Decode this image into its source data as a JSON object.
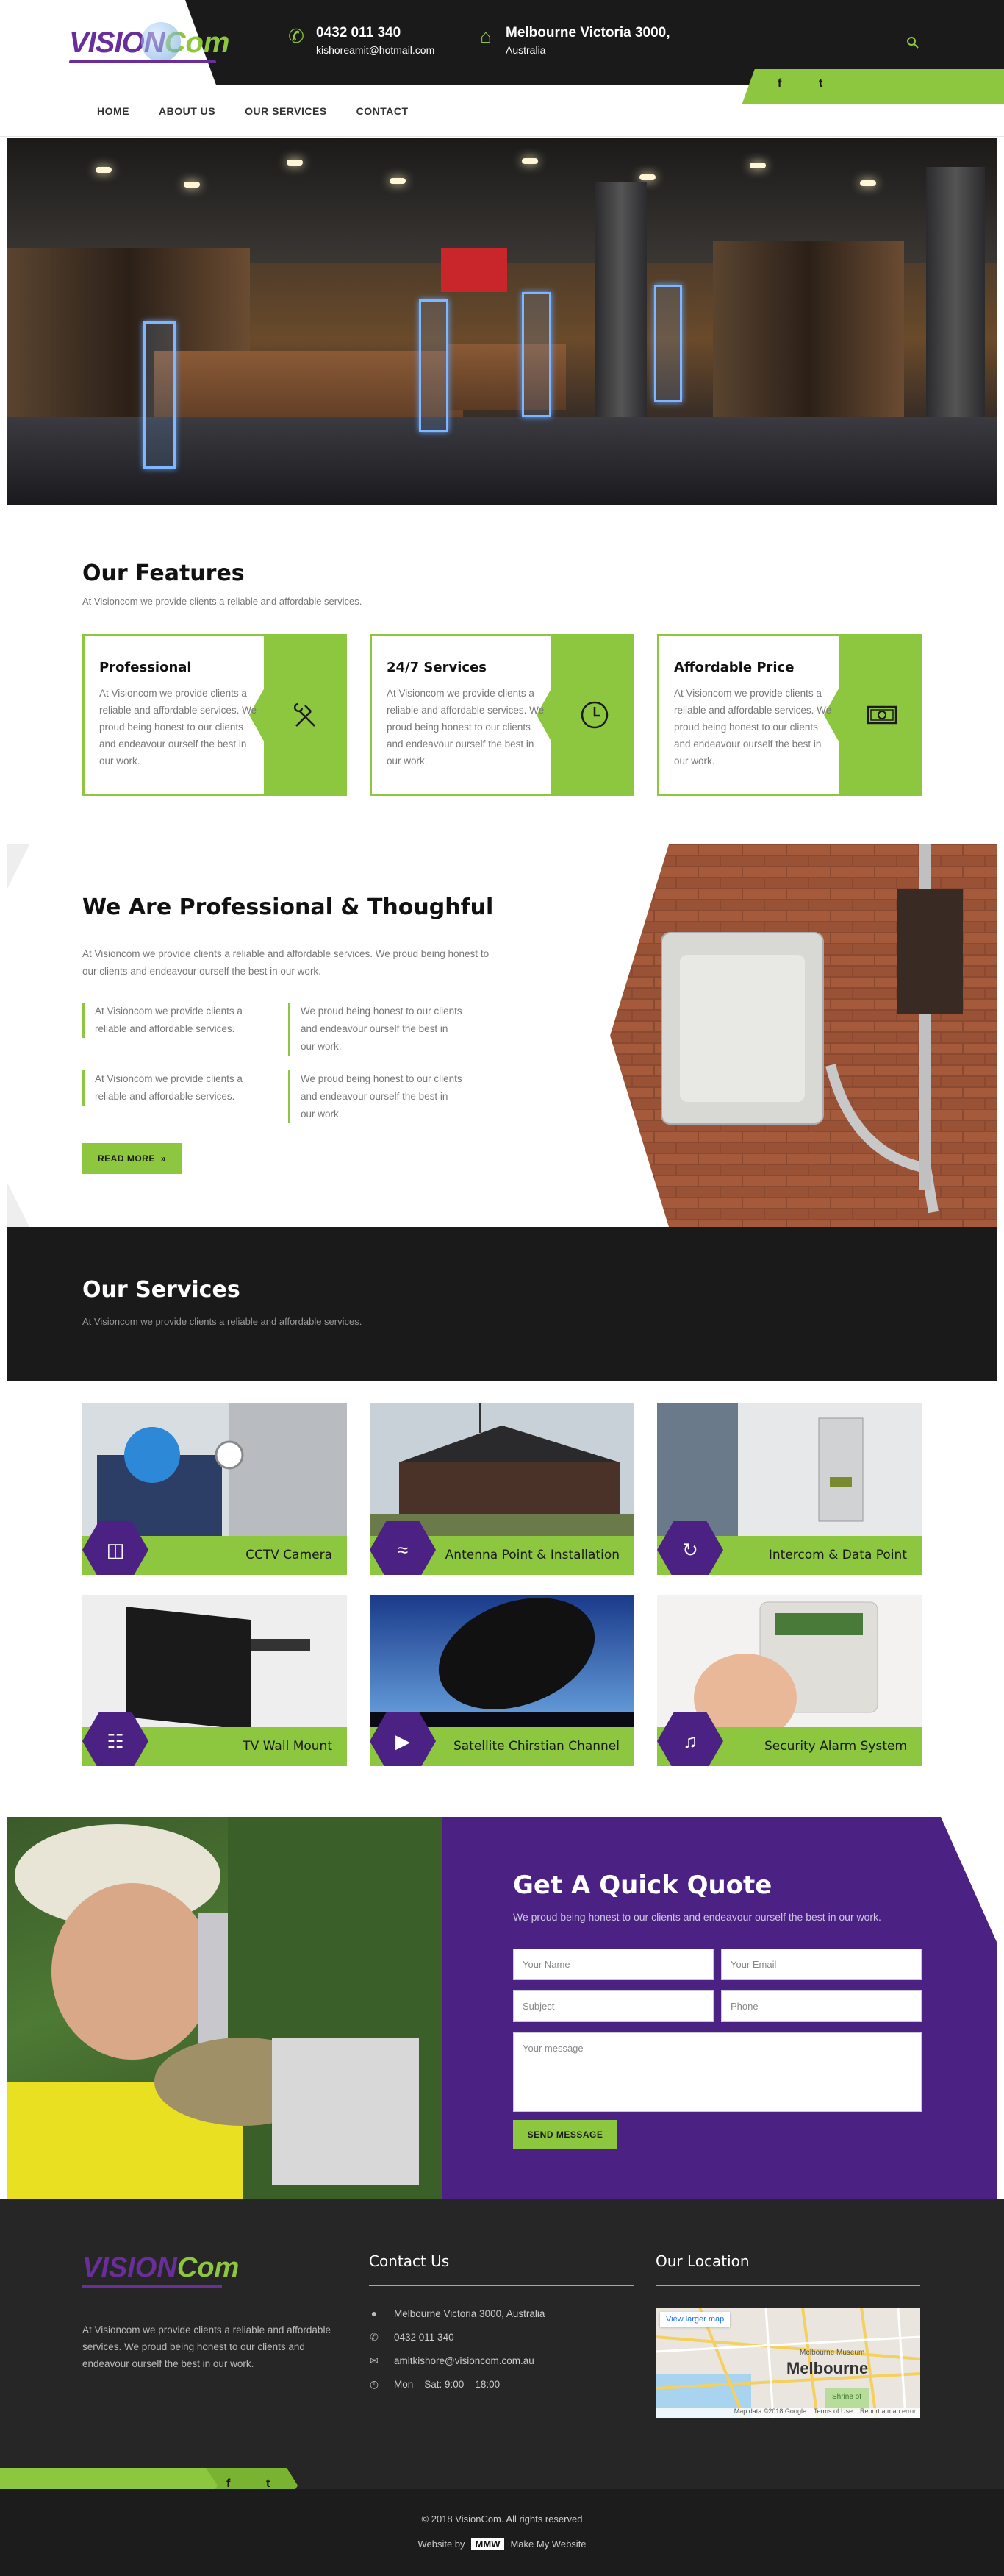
{
  "brand": {
    "logo_part1": "VISION",
    "logo_part2": "Com"
  },
  "header": {
    "phone": "0432 011 340",
    "email": "kishoreamit@hotmail.com",
    "address": "Melbourne Victoria 3000,",
    "country": "Australia",
    "search_icon": "search-icon",
    "social": [
      "f",
      "t"
    ]
  },
  "nav": [
    "HOME",
    "ABOUT US",
    "OUR SERVICES",
    "CONTACT"
  ],
  "features": {
    "title": "Our Features",
    "subtitle": "At Visioncom we provide clients a reliable and affordable services.",
    "items": [
      {
        "title": "Professional",
        "text": "At Visioncom we provide clients a reliable and affordable services. We proud being honest to our clients and endeavour ourself the best in our work.",
        "icon": "tools-icon"
      },
      {
        "title": "24/7 Services",
        "text": "At Visioncom we provide clients a reliable and affordable services. We proud being honest to our clients and endeavour ourself the best in our work.",
        "icon": "clock-icon"
      },
      {
        "title": "Affordable Price",
        "text": "At Visioncom we provide clients a reliable and affordable services. We proud being honest to our clients and endeavour ourself the best in our work.",
        "icon": "money-icon"
      }
    ]
  },
  "professional": {
    "title": "We Are Professional & Thoughful",
    "intro": "At Visioncom we provide clients a reliable and affordable services. We proud being honest to our clients and endeavour ourself the best in our work.",
    "items": [
      "At Visioncom we provide clients a reliable and affordable services.",
      "We proud being honest to our clients and endeavour ourself the best in our work.",
      "At Visioncom we provide clients a reliable and affordable services.",
      "We proud being honest to our clients and endeavour ourself the best in our work."
    ],
    "button": "READ MORE"
  },
  "services": {
    "title": "Our Services",
    "subtitle": "At Visioncom we provide clients a reliable and affordable services.",
    "items": [
      {
        "label": "CCTV Camera",
        "icon": "video-camera-icon"
      },
      {
        "label": "Antenna Point & Installation",
        "icon": "wifi-icon"
      },
      {
        "label": "Intercom & Data Point",
        "icon": "refresh-icon"
      },
      {
        "label": "TV Wall Mount",
        "icon": "sitemap-icon"
      },
      {
        "label": "Satellite Chirstian Channel",
        "icon": "play-icon"
      },
      {
        "label": "Security Alarm System",
        "icon": "bell-icon"
      }
    ]
  },
  "quote": {
    "title": "Get A Quick Quote",
    "subtitle": "We proud being honest to our clients and endeavour ourself the best in our work.",
    "name_ph": "Your Name",
    "email_ph": "Your Email",
    "subject_ph": "Subject",
    "phone_ph": "Phone",
    "message_ph": "Your message",
    "button": "SEND MESSAGE"
  },
  "footer": {
    "about": "At Visioncom we provide clients a reliable and affordable services. We proud being honest to our clients and endeavour ourself the best in our work.",
    "contact_title": "Contact Us",
    "address": "Melbourne Victoria 3000, Australia",
    "phone": "0432 011 340",
    "email": "amitkishore@visioncom.com.au",
    "hours": "Mon – Sat: 9:00 – 18:00",
    "location_title": "Our Location",
    "map_link": "View larger map",
    "map_city": "Melbourne",
    "map_museum": "Melbourne Museum",
    "map_shrine": "Shrine of",
    "map_credit": "Map data ©2018 Google",
    "map_terms": "Terms of Use",
    "map_report": "Report a map error",
    "social": [
      "f",
      "t"
    ],
    "copyright": "© 2018 VisionCom. All rights reserved",
    "website_by": "Website by",
    "maker": "Make My Website"
  }
}
